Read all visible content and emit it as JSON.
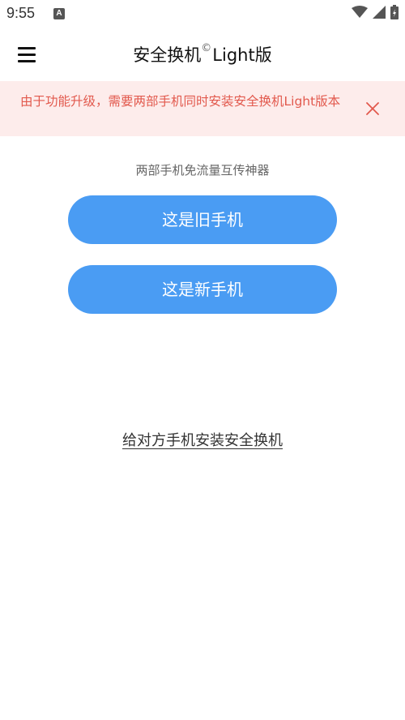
{
  "status_bar": {
    "time": "9:55",
    "notification_icon": "font-A",
    "icons": [
      "wifi-icon",
      "signal-icon",
      "battery-icon"
    ]
  },
  "app_bar": {
    "menu_icon": "hamburger-menu",
    "title_prefix": "安全换机",
    "title_mark": "©",
    "title_suffix": "Light版"
  },
  "banner": {
    "message": "由于功能升级，需要两部手机同时安装安全换机Light版本",
    "close_icon": "close-icon",
    "text_color": "#e2594d",
    "background": "#fdeceb"
  },
  "main": {
    "subtitle": "两部手机免流量互传神器",
    "old_phone_button": "这是旧手机",
    "new_phone_button": "这是新手机",
    "install_link": "给对方手机安装安全换机",
    "button_color": "#4a9cf3"
  }
}
